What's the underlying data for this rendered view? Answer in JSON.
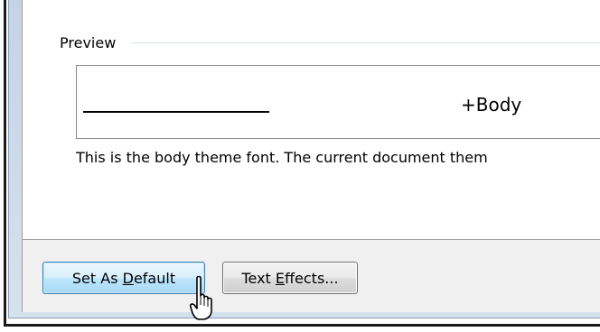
{
  "preview": {
    "group_label": "Preview",
    "sample_text": "+Body",
    "description": "This is the body theme font. The current document them"
  },
  "buttons": {
    "set_as_default": {
      "prefix": "Set As ",
      "mnemonic": "D",
      "suffix": "efault"
    },
    "text_effects": {
      "prefix": "Text ",
      "mnemonic": "E",
      "suffix": "ffects..."
    }
  },
  "cursor": {
    "icon": "hand-pointer-icon"
  }
}
